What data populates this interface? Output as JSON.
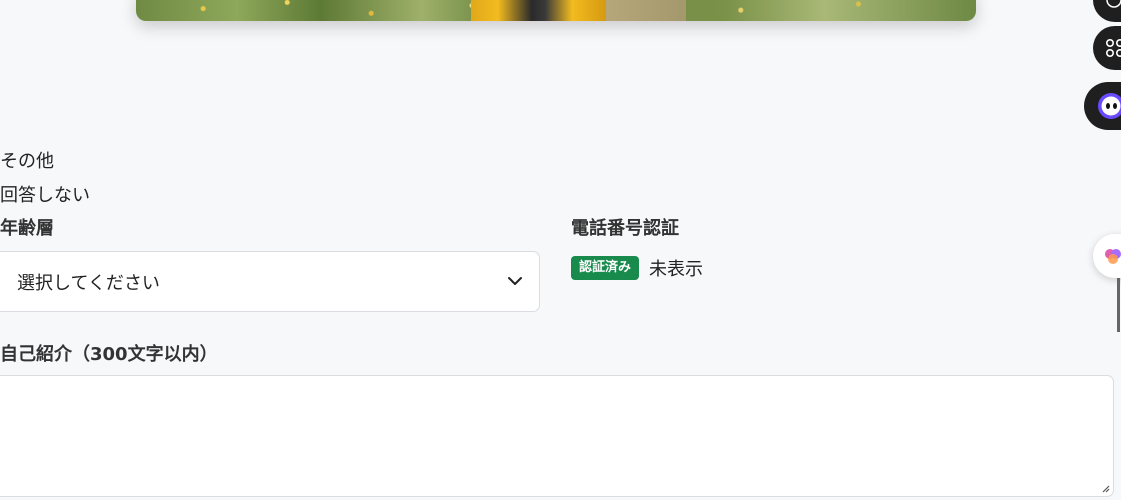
{
  "hero": {
    "description_icon": "photo-banner"
  },
  "options": [
    "その他",
    "回答しない"
  ],
  "fields": {
    "age_label": "年齢層",
    "age_select_value": "選択してください",
    "phone_label": "電話番号認証",
    "phone_badge": "認証済み",
    "phone_visibility": "未表示",
    "bio_label": "自己紹介（300文字以内）"
  },
  "colors": {
    "background": "#f7f8fa",
    "badge": "#178a4c"
  },
  "icons": {
    "select": "chevron-down-icon",
    "fab2": "apps-grid-icon",
    "fab3": "assistant-face-icon",
    "side": "brain-icon"
  }
}
